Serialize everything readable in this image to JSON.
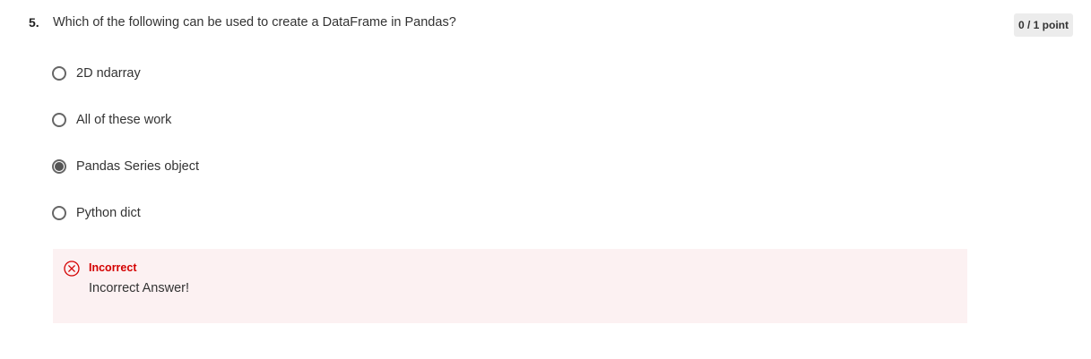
{
  "question": {
    "number": "5.",
    "text": "Which of the following can be used to create a DataFrame in Pandas?",
    "points": "0 / 1 point"
  },
  "options": [
    {
      "label": "2D ndarray",
      "selected": false
    },
    {
      "label": "All of these work",
      "selected": false
    },
    {
      "label": "Pandas Series object",
      "selected": true
    },
    {
      "label": "Python dict",
      "selected": false
    }
  ],
  "feedback": {
    "status": "Incorrect",
    "message": "Incorrect Answer!",
    "icon": "x-circle-icon",
    "status_color": "#d40000",
    "background_color": "#fcf1f2"
  }
}
